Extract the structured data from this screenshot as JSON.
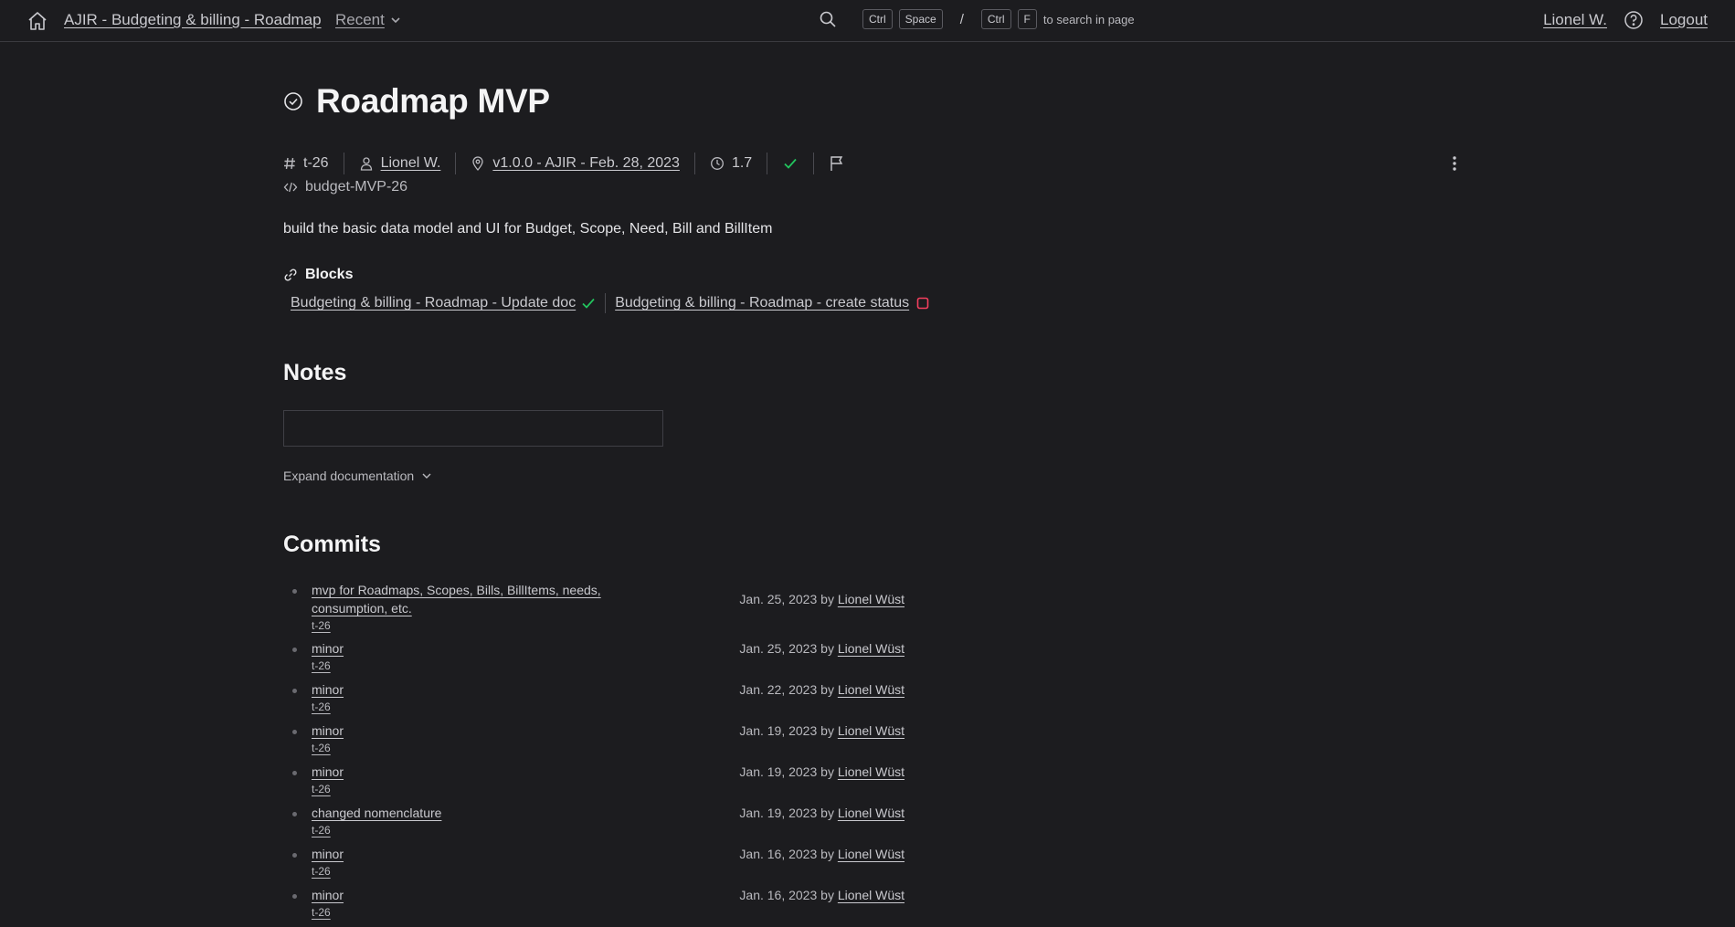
{
  "topbar": {
    "breadcrumb": "AJIR - Budgeting & billing - Roadmap",
    "recent_label": "Recent",
    "search": {
      "keys1": [
        "Ctrl",
        "Space"
      ],
      "separator": "/",
      "keys2": [
        "Ctrl",
        "F"
      ],
      "hint": "to search in page"
    },
    "user": "Lionel W.",
    "logout": "Logout"
  },
  "task": {
    "title": "Roadmap MVP",
    "id": "t-26",
    "assignee": "Lionel W.",
    "milestone": "v1.0.0 - AJIR - Feb. 28, 2023",
    "estimate": "1.7",
    "code": "budget-MVP-26",
    "description": "build the basic data model and UI for Budget, Scope, Need, Bill and BillItem"
  },
  "blocks": {
    "heading": "Blocks",
    "items": [
      {
        "label": "Budgeting & billing - Roadmap - Update doc",
        "status": "done"
      },
      {
        "label": "Budgeting & billing - Roadmap - create status",
        "status": "todo"
      }
    ]
  },
  "notes": {
    "heading": "Notes",
    "expand_label": "Expand documentation"
  },
  "commits": {
    "heading": "Commits",
    "items": [
      {
        "message": "mvp for Roadmaps, Scopes, Bills, BillItems, needs, consumption, etc.",
        "tag": "t-26",
        "date": "Jan. 25, 2023",
        "by": "by",
        "author": "Lionel Wüst"
      },
      {
        "message": "minor",
        "tag": "t-26",
        "date": "Jan. 25, 2023",
        "by": "by",
        "author": "Lionel Wüst"
      },
      {
        "message": "minor",
        "tag": "t-26",
        "date": "Jan. 22, 2023",
        "by": "by",
        "author": "Lionel Wüst"
      },
      {
        "message": "minor",
        "tag": "t-26",
        "date": "Jan. 19, 2023",
        "by": "by",
        "author": "Lionel Wüst"
      },
      {
        "message": "minor",
        "tag": "t-26",
        "date": "Jan. 19, 2023",
        "by": "by",
        "author": "Lionel Wüst"
      },
      {
        "message": "changed nomenclature",
        "tag": "t-26",
        "date": "Jan. 19, 2023",
        "by": "by",
        "author": "Lionel Wüst"
      },
      {
        "message": "minor",
        "tag": "t-26",
        "date": "Jan. 16, 2023",
        "by": "by",
        "author": "Lionel Wüst"
      },
      {
        "message": "minor",
        "tag": "t-26",
        "date": "Jan. 16, 2023",
        "by": "by",
        "author": "Lionel Wüst"
      }
    ]
  },
  "colors": {
    "background": "#1c1c1f",
    "success": "#22c55e",
    "danger": "#f43f5e"
  }
}
